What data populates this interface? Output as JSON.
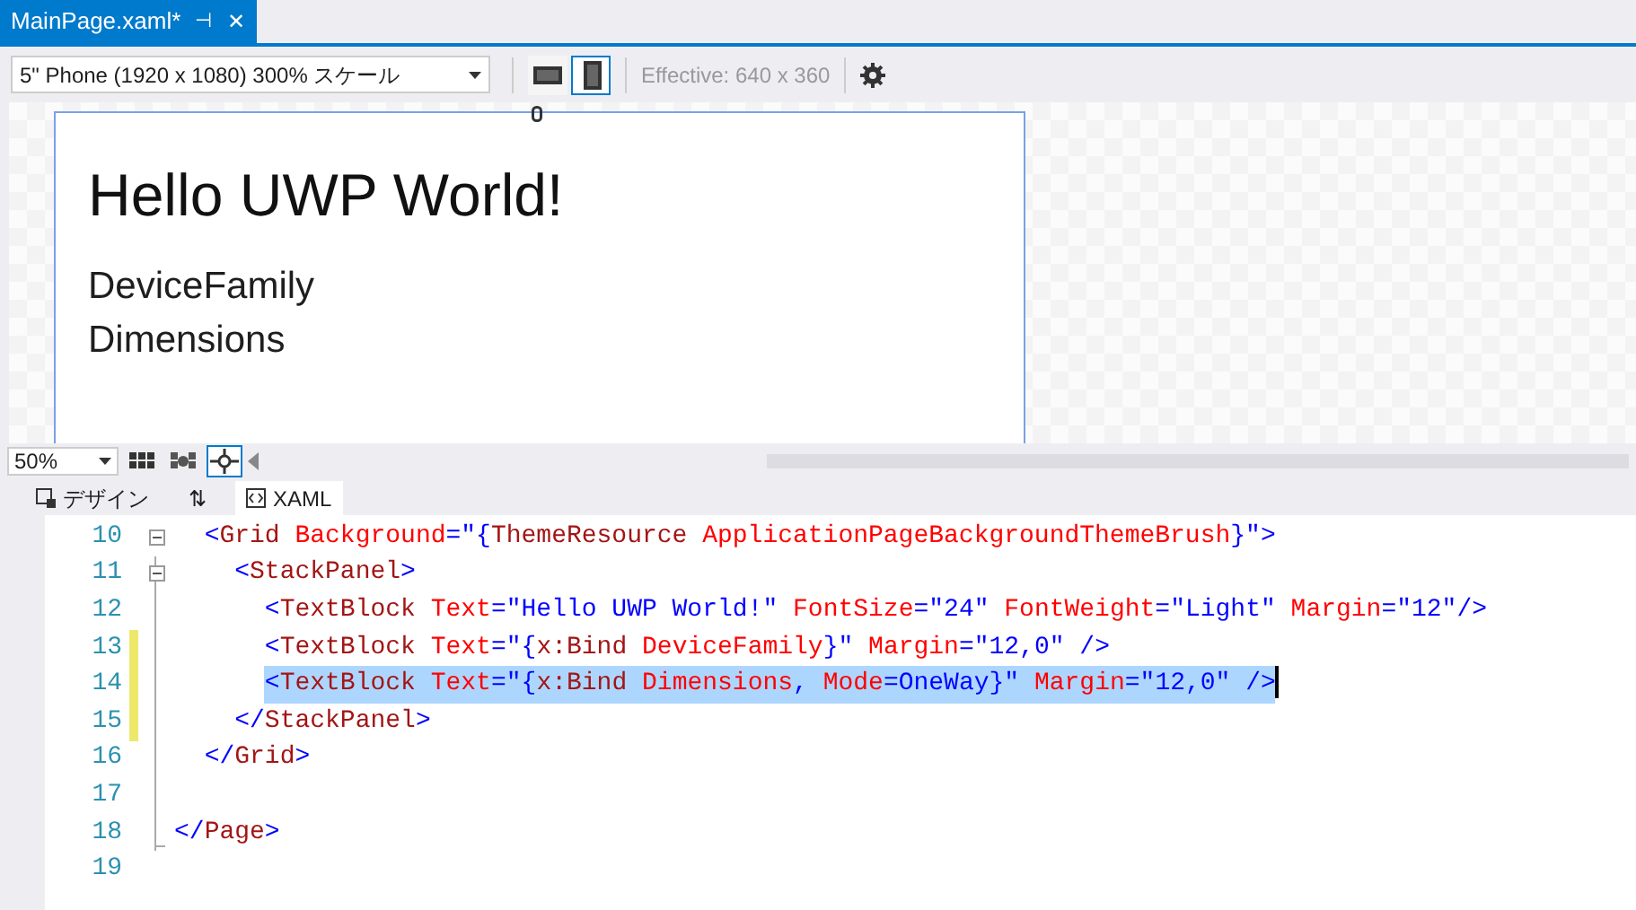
{
  "document_tab": {
    "title": "MainPage.xaml*",
    "pin": "⊣",
    "close": "✕",
    "selected": true
  },
  "toolbar": {
    "device": "5\" Phone (1920 x 1080) 300% スケール",
    "orientations": [
      {
        "kind": "landscape",
        "selected": false
      },
      {
        "kind": "portrait",
        "selected": true
      }
    ],
    "effective": "Effective: 640 x 360"
  },
  "preview": {
    "title": "Hello UWP World!",
    "lines": [
      "DeviceFamily",
      "Dimensions"
    ]
  },
  "zoom_bar": {
    "zoom": "50%",
    "tools": [
      {
        "kind": "grid",
        "selected": false
      },
      {
        "kind": "snap",
        "selected": false
      },
      {
        "kind": "snap_lines",
        "selected": true
      }
    ]
  },
  "view_tabs": [
    {
      "kind": "design",
      "label": "デザイン",
      "selected": false
    },
    {
      "kind": "swap",
      "label": "⇅",
      "selected": false
    },
    {
      "kind": "xaml",
      "label": "XAML",
      "selected": true
    }
  ],
  "code_lines": [
    {
      "number": "10",
      "expanded": true,
      "changed": false,
      "selected": false,
      "tokens": [
        {
          "kind": "punct",
          "text": "  <"
        },
        {
          "kind": "tag",
          "text": "Grid"
        },
        {
          "kind": "attr",
          "text": " Background"
        },
        {
          "kind": "punct",
          "text": "=\"{"
        },
        {
          "kind": "tag",
          "text": "ThemeResource"
        },
        {
          "kind": "attr",
          "text": " ApplicationPageBackgroundThemeBrush"
        },
        {
          "kind": "punct",
          "text": "}\">"
        }
      ]
    },
    {
      "number": "11",
      "expanded": true,
      "changed": false,
      "selected": false,
      "tokens": [
        {
          "kind": "punct",
          "text": "    <"
        },
        {
          "kind": "tag",
          "text": "StackPanel"
        },
        {
          "kind": "punct",
          "text": ">"
        }
      ]
    },
    {
      "number": "12",
      "changed": false,
      "selected": false,
      "tokens": [
        {
          "kind": "punct",
          "text": "      <"
        },
        {
          "kind": "tag",
          "text": "TextBlock"
        },
        {
          "kind": "attr",
          "text": " Text"
        },
        {
          "kind": "punct",
          "text": "=\"Hello UWP World!\""
        },
        {
          "kind": "attr",
          "text": " FontSize"
        },
        {
          "kind": "punct",
          "text": "=\"24\""
        },
        {
          "kind": "attr",
          "text": " FontWeight"
        },
        {
          "kind": "punct",
          "text": "=\"Light\""
        },
        {
          "kind": "attr",
          "text": " Margin"
        },
        {
          "kind": "punct",
          "text": "=\"12\"/>"
        }
      ]
    },
    {
      "number": "13",
      "changed": true,
      "selected": false,
      "tokens": [
        {
          "kind": "punct",
          "text": "      <"
        },
        {
          "kind": "tag",
          "text": "TextBlock"
        },
        {
          "kind": "attr",
          "text": " Text"
        },
        {
          "kind": "punct",
          "text": "=\"{"
        },
        {
          "kind": "tag",
          "text": "x:Bind"
        },
        {
          "kind": "attr",
          "text": " DeviceFamily"
        },
        {
          "kind": "punct",
          "text": "}\""
        },
        {
          "kind": "attr",
          "text": " Margin"
        },
        {
          "kind": "punct",
          "text": "=\"12,0\" />"
        }
      ]
    },
    {
      "number": "14",
      "changed": true,
      "selected": true,
      "tokens": [
        {
          "kind": "punct",
          "text": "      <"
        },
        {
          "kind": "tag",
          "text": "TextBlock"
        },
        {
          "kind": "attr",
          "text": " Text"
        },
        {
          "kind": "punct",
          "text": "=\"{"
        },
        {
          "kind": "tag",
          "text": "x:Bind"
        },
        {
          "kind": "attr",
          "text": " Dimensions"
        },
        {
          "kind": "punct",
          "text": ", "
        },
        {
          "kind": "attr",
          "text": "Mode"
        },
        {
          "kind": "punct",
          "text": "=OneWay}\""
        },
        {
          "kind": "attr",
          "text": " Margin"
        },
        {
          "kind": "punct",
          "text": "=\"12,0\" />"
        }
      ]
    },
    {
      "number": "15",
      "changed": true,
      "selected": false,
      "tokens": [
        {
          "kind": "punct",
          "text": "    </"
        },
        {
          "kind": "tag",
          "text": "StackPanel"
        },
        {
          "kind": "punct",
          "text": ">"
        }
      ]
    },
    {
      "number": "16",
      "changed": false,
      "selected": false,
      "tokens": [
        {
          "kind": "punct",
          "text": "  </"
        },
        {
          "kind": "tag",
          "text": "Grid"
        },
        {
          "kind": "punct",
          "text": ">"
        }
      ]
    },
    {
      "number": "17",
      "changed": false,
      "selected": false
    },
    {
      "number": "18",
      "changed": false,
      "selected": false,
      "tokens": [
        {
          "kind": "punct",
          "text": "</"
        },
        {
          "kind": "tag",
          "text": "Page"
        },
        {
          "kind": "punct",
          "text": ">"
        }
      ]
    },
    {
      "number": "19",
      "changed": false,
      "selected": false
    }
  ]
}
